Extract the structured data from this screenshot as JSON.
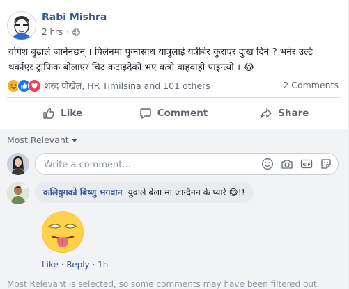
{
  "post": {
    "author": "Rabi Mishra",
    "time": "2 hrs",
    "privacy_icon": "globe-icon",
    "text": "योगेश बुढाले जानेनछन् । पिलेनमा पुग्नासाथ यात्रुलाई यत्रीबेर कुराएर दुःख दिने ? भनेर उल्टै थर्काएर ट्राफिक बोलाएर चिट कटाइदेको भए कत्रो वाहवाही पाइन्त्यो । 😂"
  },
  "reactions": {
    "names": "शरद पोखेल, HR Timilsina and 101 others",
    "comment_count": "2 Comments",
    "icons": [
      "haha-reaction-icon",
      "like-reaction-icon",
      "love-reaction-icon"
    ]
  },
  "actions": {
    "like": "Like",
    "comment": "Comment",
    "share": "Share"
  },
  "comments": {
    "sort_label": "Most Relevant",
    "composer_placeholder": "Write a comment...",
    "items": [
      {
        "author": "कलियुगको बिष्णु भगवान",
        "text": "युवाले बेला मा जान्दैनन के प्यारे 😋!!",
        "like": "Like",
        "reply": "Reply",
        "time": "1h"
      }
    ],
    "filter_note": "Most Relevant is selected, so some comments may have been filtered out."
  },
  "colors": {
    "link": "#365899",
    "muted": "#606770",
    "background": "#e9ebee"
  }
}
